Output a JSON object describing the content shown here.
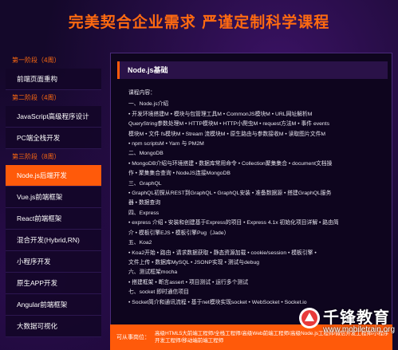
{
  "banner": {
    "title": "完美契合企业需求 严谨定制科学课程"
  },
  "sidebar": {
    "stages": [
      {
        "label": "第一阶段（4周）",
        "items": [
          "前端页面重构"
        ]
      },
      {
        "label": "第二阶段（4周）",
        "items": [
          "JavaScript高级程序设计",
          "PC端全栈开发"
        ]
      },
      {
        "label": "第三阶段（8周）",
        "items": [
          "Node.js后端开发",
          "Vue.js前端框架",
          "React前端框架",
          "混合开发(Hybrid,RN)",
          "小程序开发",
          "原生APP开发",
          "Angular前端框架",
          "大数据可视化"
        ]
      }
    ],
    "active": "Node.js后端开发"
  },
  "panel": {
    "title": "Node.js基础",
    "intro": "课程内容：",
    "lines": [
      "一、Node.js介绍",
      "• 开发环境搭建M  • 模块与包管理工具M  • CommonJS模块M  • URL网址解析M",
      "QueryString参数处理M  • HTTP模块M  • HTTP小爬虫M  • request方法M  • 事件 events",
      "模块M  • 文件 fs模块M  • Stream 流模块M  • 原生路由与参数接收M  • 读取图片文件M",
      "• npm scriptsM  • Yarn 与 PM2M",
      "二、MongoDB",
      "• MongoDB介绍与环境搭建  • 数据库常用命令  • Collection聚集集合  • document文档操",
      "作  • 聚集集合查询  • NodeJS连接MongoDB",
      "三、GraphQL",
      "• GraphQL初探从REST到GraphQL  • GraphQL安装  • 准备数据源  • 搭建GraphQL服务",
      "器  • 数据查询",
      "四、Express",
      "• express 介绍  • 安装和创建基于Express的项目  • Express 4.1x 初始化项目详解  • 路由简",
      "介  • 模板引擎EJS  • 模板引擎Pug（Jade）",
      "五、Koa2",
      "• Koa2开始  • 路由  • 请求数据获取  • 静态资源加载  • cookie/session  • 模板引擎  •",
      "文件上传  • 数据库MySQL  • JSONP实现  • 测试与debug",
      "六、测试框架mocha",
      "• 搭建框架  • 断言assert  • 项目测试  • 运行多个测试",
      "七、socket 即时通信项目",
      "• Socket简介和通讯流程  • 基于net模块实现socket  • WebSocket  • Socket.io"
    ]
  },
  "footer": {
    "label": "可从事岗位：",
    "text": "高级HTML5大前端工程师/全栈工程师/高级Web前端工程师/高级Node.js工程师/微信开发工程师/小程序开发工程师/移动端前端工程师"
  },
  "logo": {
    "cn": "千锋教育",
    "en": "www.mobiletrain.org"
  }
}
